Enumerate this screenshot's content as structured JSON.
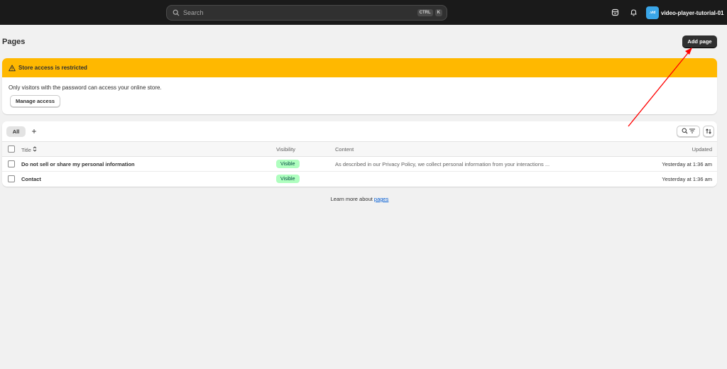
{
  "topbar": {
    "search_placeholder": "Search",
    "shortcut_keys": [
      "CTRL",
      "K"
    ],
    "store_avatar_text": ".vid",
    "store_name": "video-player-tutorial-01"
  },
  "page": {
    "title": "Pages",
    "add_button": "Add page"
  },
  "banner": {
    "title": "Store access is restricted",
    "text": "Only visitors with the password can access your online store.",
    "button": "Manage access",
    "color": "#ffb800"
  },
  "table": {
    "tabs": {
      "all": "All",
      "add": "+"
    },
    "headers": {
      "title": "Title",
      "visibility": "Visibility",
      "content": "Content",
      "updated": "Updated"
    },
    "rows": [
      {
        "title": "Do not sell or share my personal information",
        "visibility": "Visible",
        "content": "As described in our Privacy Policy, we collect personal information from your interactions ...",
        "updated": "Yesterday at 1:36 am"
      },
      {
        "title": "Contact",
        "visibility": "Visible",
        "content": "",
        "updated": "Yesterday at 1:36 am"
      }
    ]
  },
  "footer": {
    "learn_prefix": "Learn more about ",
    "learn_link": "pages"
  },
  "icons": {
    "search": "search-icon",
    "shop": "shop-icon",
    "bell": "bell-icon",
    "warning": "warning-icon",
    "filter": "search-filter-icon",
    "sort": "sort-icon"
  },
  "colors": {
    "topbar": "#1a1a1a",
    "primary_button": "#303030",
    "badge_bg": "#affebf",
    "link": "#005bd3",
    "annotation_arrow": "#ff0000"
  }
}
